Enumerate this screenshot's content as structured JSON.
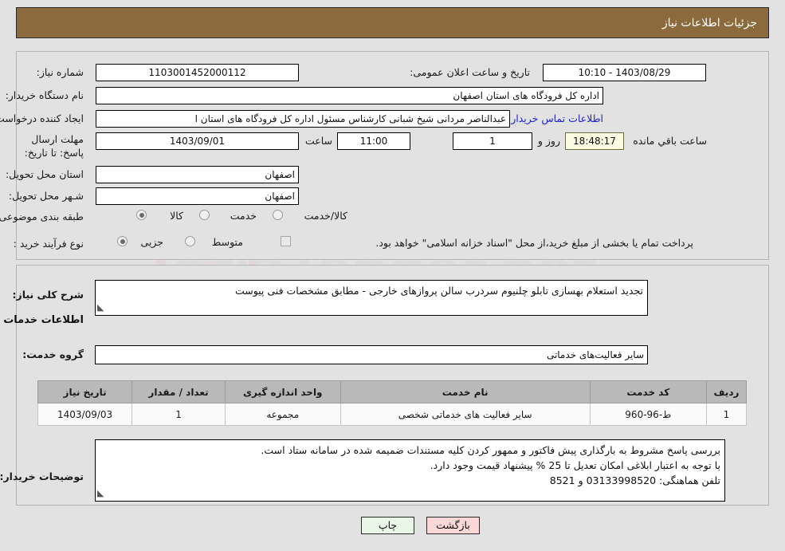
{
  "header": {
    "title": "جزئیات اطلاعات نیاز",
    "bar_color": "#8b6b3d"
  },
  "form": {
    "need_number_label": "شماره نیاز:",
    "need_number_value": "1103001452000112",
    "announce_label": "تاریخ و ساعت اعلان عمومی:",
    "announce_value": "1403/08/29 - 10:10",
    "buyer_org_label": "نام دستگاه خریدار:",
    "buyer_org_value": "اداره کل فرودگاه های استان اصفهان",
    "creator_label": "ایجاد کننده درخواست:",
    "creator_value": "عبدالناصر مردانی شیخ شبانی کارشناس مسئول  اداره کل فرودگاه های استان ا",
    "contact_link": "اطلاعات تماس خریدار",
    "deadline_label": "مهلت ارسال پاسخ: تا تاریخ:",
    "deadline_date": "1403/09/01",
    "hour_label": "ساعت",
    "deadline_time": "11:00",
    "days_value": "1",
    "days_suffix": "روز و",
    "countdown_value": "18:48:17",
    "countdown_suffix": "ساعت باقي مانده",
    "province_label": "استان محل تحویل:",
    "province_value": "اصفهان",
    "city_label": "شـهر محل تحویل:",
    "city_value": "اصفهان",
    "category_label": "طبقه بندی موضوعی:",
    "category_options": [
      "کالا",
      "خدمت",
      "کالا/خدمت"
    ],
    "category_selected_index": 0,
    "process_label": "نوع فرآیند خرید :",
    "process_options": [
      "جزیی",
      "متوسط"
    ],
    "process_selected_index": 0,
    "payment_note": "پرداخت تمام یا بخشی از مبلغ خرید،از محل \"اسناد خزانه اسلامی\" خواهد بود."
  },
  "description": {
    "label": "شرح کلی نیاز:",
    "value": "تجدید استعلام بهسازی تابلو چلنیوم سردرب سالن پروازهای خارجی - مطابق مشخصات فنی پیوست"
  },
  "services_section": {
    "heading": "اطلاعات خدمات مورد نیاز",
    "group_label": "گروه خدمت:",
    "group_value": "سایر فعالیت‌های خدماتی"
  },
  "table": {
    "columns": [
      "ردیف",
      "کد خدمت",
      "نام خدمت",
      "واحد اندازه گیری",
      "تعداد / مقدار",
      "تاریخ نیاز"
    ],
    "rows": [
      {
        "row_no": "1",
        "service_code": "ط-96-960",
        "service_name": "سایر فعالیت های خدماتی شخصی",
        "unit": "مجموعه",
        "quantity": "1",
        "need_date": "1403/09/03"
      }
    ]
  },
  "buyer_notes": {
    "label": "توضیحات خریدار:",
    "lines": [
      "بررسی پاسخ مشروط  به بارگذاری پیش فاکتور و ممهور کردن کلیه مستندات ضمیمه شده در سامانه  ستاد است.",
      "با توجه به اعتبار ابلاغی امکان تعدیل تا 25 % پیشنهاد قیمت وجود دارد.",
      "تلفن هماهنگی: 03133998520 و 8521"
    ]
  },
  "footer": {
    "print_label": "چاپ",
    "back_label": "بازگشت"
  },
  "watermark": {
    "text": "AriaTender.net"
  }
}
